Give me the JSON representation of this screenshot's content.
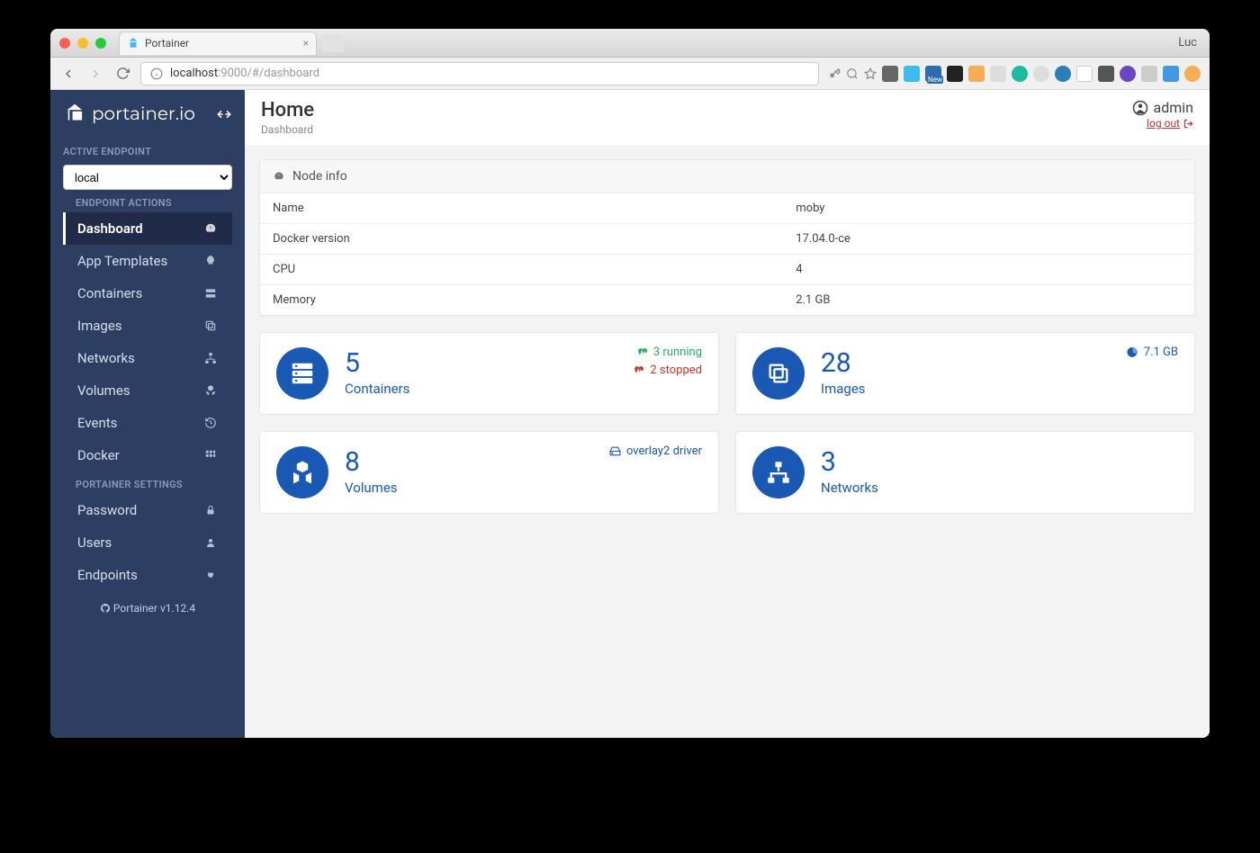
{
  "browser": {
    "tab_title": "Portainer",
    "profile": "Luc",
    "url_host": "localhost",
    "url_port": ":9000",
    "url_path": "/#/dashboard"
  },
  "brand": "portainer.io",
  "sidebar": {
    "label_active": "ACTIVE ENDPOINT",
    "endpoint_value": "local",
    "label_actions": "ENDPOINT ACTIONS",
    "items": [
      {
        "label": "Dashboard",
        "icon": "tachometer"
      },
      {
        "label": "App Templates",
        "icon": "rocket"
      },
      {
        "label": "Containers",
        "icon": "server"
      },
      {
        "label": "Images",
        "icon": "clone"
      },
      {
        "label": "Networks",
        "icon": "sitemap"
      },
      {
        "label": "Volumes",
        "icon": "cubes"
      },
      {
        "label": "Events",
        "icon": "history"
      },
      {
        "label": "Docker",
        "icon": "th"
      }
    ],
    "label_settings": "PORTAINER SETTINGS",
    "settings": [
      {
        "label": "Password",
        "icon": "lock"
      },
      {
        "label": "Users",
        "icon": "user"
      },
      {
        "label": "Endpoints",
        "icon": "plug"
      }
    ],
    "footer": "Portainer v1.12.4"
  },
  "header": {
    "title": "Home",
    "breadcrumb": "Dashboard",
    "username": "admin",
    "logout": "log out"
  },
  "node_info": {
    "panel_title": "Node info",
    "rows": [
      {
        "k": "Name",
        "v": "moby"
      },
      {
        "k": "Docker version",
        "v": "17.04.0-ce"
      },
      {
        "k": "CPU",
        "v": "4"
      },
      {
        "k": "Memory",
        "v": "2.1 GB"
      }
    ]
  },
  "cards": {
    "containers": {
      "count": "5",
      "label": "Containers",
      "running": "3 running",
      "stopped": "2 stopped"
    },
    "images": {
      "count": "28",
      "label": "Images",
      "size": "7.1 GB"
    },
    "volumes": {
      "count": "8",
      "label": "Volumes",
      "driver": "overlay2 driver"
    },
    "networks": {
      "count": "3",
      "label": "Networks"
    }
  }
}
